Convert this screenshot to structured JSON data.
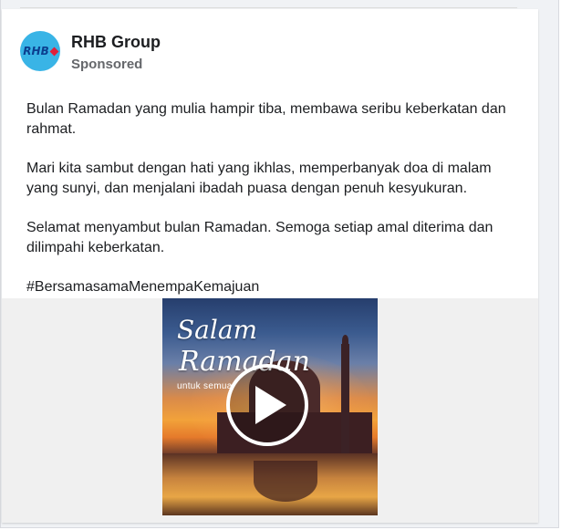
{
  "post": {
    "page_name": "RHB Group",
    "sponsored_label": "Sponsored",
    "avatar_logo_text": "RHB",
    "paragraphs": [
      "Bulan Ramadan yang mulia hampir tiba, membawa seribu keberkatan dan rahmat.",
      "Mari kita sambut dengan hati yang ikhlas, memperbanyak doa di malam yang sunyi, dan menjalani ibadah puasa dengan penuh kesyukuran.",
      "Selamat menyambut bulan Ramadan. Semoga setiap amal diterima dan dilimpahi keberkatan.",
      "#BersamasamaMenempaKemajuan"
    ]
  },
  "video": {
    "title_line1": "Salam",
    "title_line2": "Ramadan",
    "tagline": "untuk semua",
    "play_icon": "play-icon"
  },
  "colors": {
    "avatar_bg": "#39b4e6",
    "logo_blue": "#0b3f8f",
    "logo_red": "#e0203b",
    "secondary_text": "#65676b"
  }
}
